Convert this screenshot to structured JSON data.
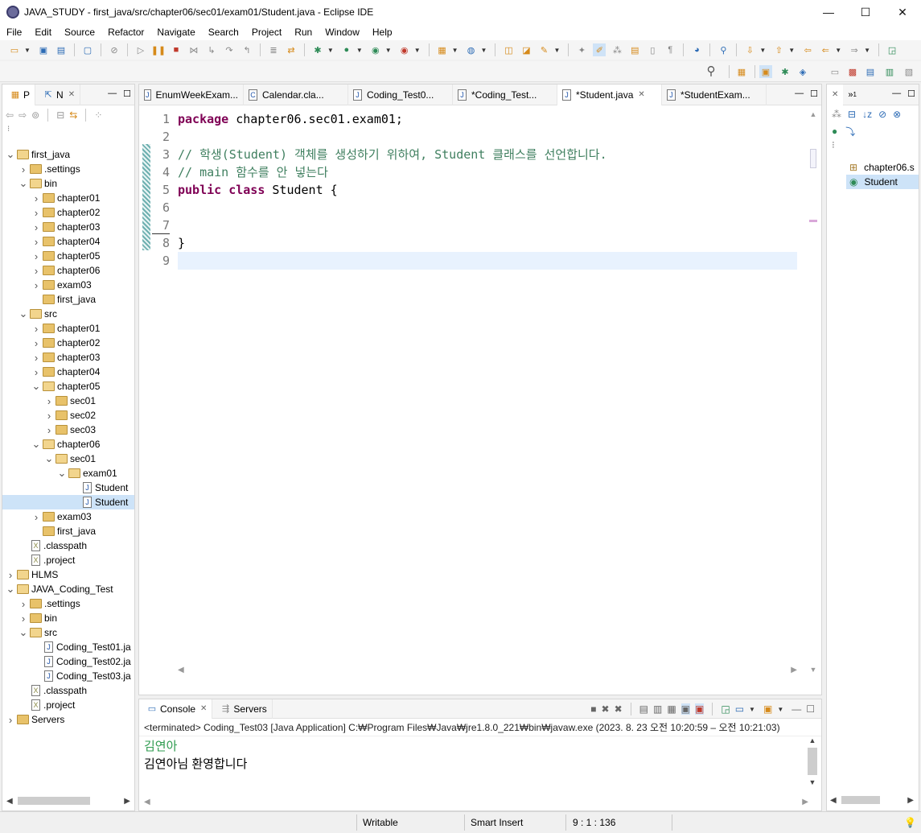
{
  "window": {
    "title": "JAVA_STUDY - first_java/src/chapter06/sec01/exam01/Student.java - Eclipse IDE",
    "minimize": "—",
    "maximize": "☐",
    "close": "✕"
  },
  "menu": [
    "File",
    "Edit",
    "Source",
    "Refactor",
    "Navigate",
    "Search",
    "Project",
    "Run",
    "Window",
    "Help"
  ],
  "left_panel": {
    "tabs": [
      "P",
      "N"
    ],
    "tree": [
      {
        "label": "first_java",
        "indent": 0,
        "icon": "project",
        "chev": "v"
      },
      {
        "label": ".settings",
        "indent": 1,
        "icon": "folder",
        "chev": ">"
      },
      {
        "label": "bin",
        "indent": 1,
        "icon": "folder-open",
        "chev": "v"
      },
      {
        "label": "chapter01",
        "indent": 2,
        "icon": "folder",
        "chev": ">"
      },
      {
        "label": "chapter02",
        "indent": 2,
        "icon": "folder",
        "chev": ">"
      },
      {
        "label": "chapter03",
        "indent": 2,
        "icon": "folder",
        "chev": ">"
      },
      {
        "label": "chapter04",
        "indent": 2,
        "icon": "folder",
        "chev": ">"
      },
      {
        "label": "chapter05",
        "indent": 2,
        "icon": "folder",
        "chev": ">"
      },
      {
        "label": "chapter06",
        "indent": 2,
        "icon": "folder",
        "chev": ">"
      },
      {
        "label": "exam03",
        "indent": 2,
        "icon": "folder",
        "chev": ">"
      },
      {
        "label": "first_java",
        "indent": 2,
        "icon": "folder",
        "chev": ""
      },
      {
        "label": "src",
        "indent": 1,
        "icon": "folder-open",
        "chev": "v"
      },
      {
        "label": "chapter01",
        "indent": 2,
        "icon": "folder",
        "chev": ">"
      },
      {
        "label": "chapter02",
        "indent": 2,
        "icon": "folder",
        "chev": ">"
      },
      {
        "label": "chapter03",
        "indent": 2,
        "icon": "folder",
        "chev": ">"
      },
      {
        "label": "chapter04",
        "indent": 2,
        "icon": "folder",
        "chev": ">"
      },
      {
        "label": "chapter05",
        "indent": 2,
        "icon": "folder-open",
        "chev": "v"
      },
      {
        "label": "sec01",
        "indent": 3,
        "icon": "folder",
        "chev": ">"
      },
      {
        "label": "sec02",
        "indent": 3,
        "icon": "folder",
        "chev": ">"
      },
      {
        "label": "sec03",
        "indent": 3,
        "icon": "folder",
        "chev": ">"
      },
      {
        "label": "chapter06",
        "indent": 2,
        "icon": "folder-open",
        "chev": "v"
      },
      {
        "label": "sec01",
        "indent": 3,
        "icon": "folder-open",
        "chev": "v"
      },
      {
        "label": "exam01",
        "indent": 4,
        "icon": "folder-open",
        "chev": "v"
      },
      {
        "label": "Student",
        "indent": 5,
        "icon": "java",
        "chev": ""
      },
      {
        "label": "Student",
        "indent": 5,
        "icon": "java",
        "chev": "",
        "selected": true
      },
      {
        "label": "exam03",
        "indent": 2,
        "icon": "folder",
        "chev": ">"
      },
      {
        "label": "first_java",
        "indent": 2,
        "icon": "folder",
        "chev": ""
      },
      {
        "label": ".classpath",
        "indent": 1,
        "icon": "xml",
        "chev": ""
      },
      {
        "label": ".project",
        "indent": 1,
        "icon": "xml",
        "chev": ""
      },
      {
        "label": "HLMS",
        "indent": 0,
        "icon": "project",
        "chev": ">"
      },
      {
        "label": "JAVA_Coding_Test",
        "indent": 0,
        "icon": "project",
        "chev": "v"
      },
      {
        "label": ".settings",
        "indent": 1,
        "icon": "folder",
        "chev": ">"
      },
      {
        "label": "bin",
        "indent": 1,
        "icon": "folder",
        "chev": ">"
      },
      {
        "label": "src",
        "indent": 1,
        "icon": "folder-open",
        "chev": "v"
      },
      {
        "label": "Coding_Test01.ja",
        "indent": 2,
        "icon": "java",
        "chev": ""
      },
      {
        "label": "Coding_Test02.ja",
        "indent": 2,
        "icon": "java",
        "chev": ""
      },
      {
        "label": "Coding_Test03.ja",
        "indent": 2,
        "icon": "java",
        "chev": ""
      },
      {
        "label": ".classpath",
        "indent": 1,
        "icon": "xml",
        "chev": ""
      },
      {
        "label": ".project",
        "indent": 1,
        "icon": "xml",
        "chev": ""
      },
      {
        "label": "Servers",
        "indent": 0,
        "icon": "folder",
        "chev": ">"
      }
    ]
  },
  "editor": {
    "tabs": [
      {
        "label": "EnumWeekExam...",
        "active": false
      },
      {
        "label": "Calendar.cla...",
        "active": false
      },
      {
        "label": "Coding_Test0...",
        "active": false
      },
      {
        "label": "*Coding_Test...",
        "active": false
      },
      {
        "label": "*Student.java",
        "active": true
      },
      {
        "label": "*StudentExam...",
        "active": false
      }
    ],
    "line_numbers": [
      "1",
      "2",
      "3",
      "4",
      "5",
      "6",
      "7",
      "8",
      "9"
    ],
    "code": {
      "l1_kw": "package",
      "l1_rest": " chapter06.sec01.exam01;",
      "l3": "// 학생(Student) 객체를 생성하기 위하여, Student 클래스를 선언합니다.",
      "l4": "// main 함수를 안 넣는다",
      "l5_kw1": "public",
      "l5_kw2": "class",
      "l5_rest": " Student {",
      "l8": "}"
    }
  },
  "outline": {
    "items": [
      "chapter06.s",
      "Student"
    ]
  },
  "console": {
    "tabs": [
      "Console",
      "Servers"
    ],
    "header": "<terminated> Coding_Test03 [Java Application] C:₩Program Files₩Java₩jre1.8.0_221₩bin₩javaw.exe  (2023. 8. 23 오전 10:20:59 – 오전 10:21:03)",
    "input_line": "김연아",
    "output_line": "김연아님 환영합니다"
  },
  "status": {
    "writable": "Writable",
    "insert_mode": "Smart Insert",
    "position": "9 : 1 : 136"
  },
  "colors": {
    "keyword": "#7f0055",
    "comment": "#3f7f5f",
    "console_input": "#2e9b4f"
  }
}
